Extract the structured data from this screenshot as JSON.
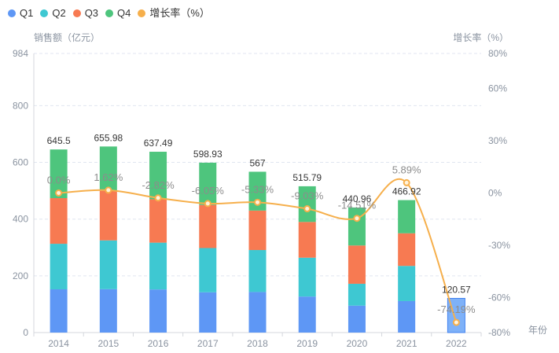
{
  "legend": {
    "items": [
      {
        "label": "Q1",
        "color": "#5E97F5"
      },
      {
        "label": "Q2",
        "color": "#3EC8D2"
      },
      {
        "label": "Q3",
        "color": "#F77A52"
      },
      {
        "label": "Q4",
        "color": "#4EC57D"
      },
      {
        "label": "增长率（%）",
        "color": "#F6AF4B"
      }
    ]
  },
  "left_axis": {
    "title": "销售额（亿元）",
    "ticks": [
      "984",
      "800",
      "600",
      "400",
      "200",
      "0"
    ],
    "tick_values": [
      984,
      800,
      600,
      400,
      200,
      0
    ],
    "min": 0,
    "max": 984
  },
  "right_axis": {
    "title": "增长率（%）",
    "ticks": [
      "80%",
      "60%",
      "30%",
      "0%",
      "-30%",
      "-60%",
      "-80%"
    ],
    "tick_values": [
      80,
      60,
      30,
      0,
      -30,
      -60,
      -80
    ],
    "min": -80,
    "max": 80
  },
  "x_axis": {
    "title": "年份",
    "categories": [
      "2014",
      "2015",
      "2016",
      "2017",
      "2018",
      "2019",
      "2020",
      "2021",
      "2022"
    ]
  },
  "chart_data": {
    "type": "bar",
    "subtype": "stacked-bars-with-growth-line",
    "grid": true,
    "legend_position": "top-left",
    "categories": [
      "2014",
      "2015",
      "2016",
      "2017",
      "2018",
      "2019",
      "2020",
      "2021",
      "2022"
    ],
    "left_ylim": [
      0,
      984
    ],
    "right_ylim": [
      -80,
      80
    ],
    "series": [
      {
        "name": "Q1",
        "type": "bar",
        "stack": true,
        "color": "#5E97F5",
        "values": [
          152.5,
          153,
          152,
          142,
          143,
          127,
          95,
          111,
          120.57
        ]
      },
      {
        "name": "Q2",
        "type": "bar",
        "stack": true,
        "color": "#3EC8D2",
        "values": [
          160.5,
          172,
          165,
          156,
          148,
          137,
          77,
          124,
          0
        ]
      },
      {
        "name": "Q3",
        "type": "bar",
        "stack": true,
        "color": "#F77A52",
        "values": [
          161,
          175,
          153,
          152,
          139,
          126,
          135,
          115,
          0
        ]
      },
      {
        "name": "Q4",
        "type": "bar",
        "stack": true,
        "color": "#4EC57D",
        "values": [
          171.5,
          155.98,
          167.49,
          148.93,
          137,
          125.79,
          133.96,
          116.92,
          0
        ]
      },
      {
        "name": "增长率（%）",
        "type": "line",
        "axis": "right",
        "color": "#F6AF4B",
        "values": [
          0.0,
          1.62,
          -2.82,
          -6.05,
          -5.33,
          -9.03,
          -14.51,
          5.89,
          -74.19
        ]
      }
    ],
    "totals": [
      645.5,
      655.98,
      637.49,
      598.93,
      567,
      515.79,
      440.96,
      466.92,
      120.57
    ],
    "total_labels": [
      "645.5",
      "655.98",
      "637.49",
      "598.93",
      "567",
      "515.79",
      "440.96",
      "466.92",
      "120.57"
    ],
    "growth_labels": [
      "0.0%",
      "1.62%",
      "-2.82%",
      "-6.05%",
      "-5.33%",
      "-9.03%",
      "-14.51%",
      "5.89%",
      "-74.19%"
    ],
    "highlighted_category": "2022",
    "highlight_style": {
      "fill": "#7EB1F8",
      "border": "#4282F0"
    }
  },
  "colors": {
    "grid_line": "#E0E5F0",
    "axis_line": "#D4D7DC",
    "tick_label": "#8A93A0",
    "total_label": "#363636",
    "growth_label": "#8C8C8C",
    "point_fill": "#FFF3DC"
  }
}
